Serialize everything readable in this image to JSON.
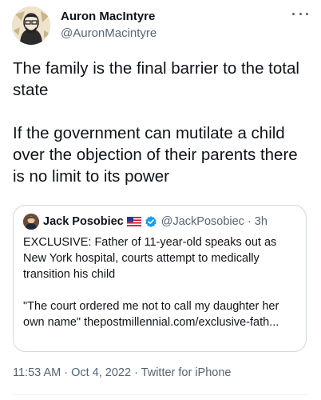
{
  "author": {
    "name": "Auron MacIntyre",
    "handle": "@AuronMacintyre"
  },
  "tweet": {
    "paragraphs": [
      "The family is the final barrier to the total state",
      "If the government can mutilate a child over the objection of their parents there is no limit to its power"
    ]
  },
  "quoted_tweet": {
    "name": "Jack Posobiec",
    "flag_icon": "us-flag-icon",
    "verified_icon": "verified-badge-icon",
    "handle": "@JackPosobiec",
    "separator": "·",
    "time": "3h",
    "paragraphs": [
      "EXCLUSIVE: Father of 11-year-old speaks out as New York hospital, courts attempt to medically transition his child",
      "\"The court ordered me not to call my daughter her own name\" thepostmillennial.com/exclusive-fath..."
    ]
  },
  "meta": {
    "text": "11:53 AM · Oct 4, 2022 · Twitter for iPhone"
  },
  "colors": {
    "text": "#0f1419",
    "secondary": "#536471",
    "verified": "#1d9bf0",
    "border": "#cfd9de"
  }
}
